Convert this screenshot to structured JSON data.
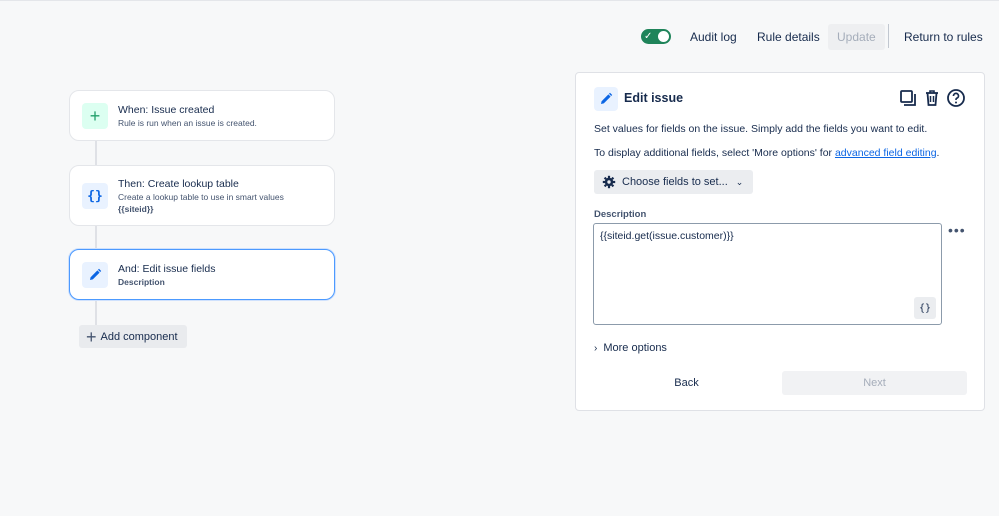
{
  "topbar": {
    "audit_log": "Audit log",
    "rule_details": "Rule details",
    "update": "Update",
    "return": "Return to rules"
  },
  "flow": {
    "trigger": {
      "title": "When: Issue created",
      "subtitle": "Rule is run when an issue is created."
    },
    "lookup": {
      "title": "Then: Create lookup table",
      "subtitle": "Create a lookup table to use in smart values",
      "detail": "{{siteid}}",
      "icon": "{}"
    },
    "edit": {
      "title": "And: Edit issue fields",
      "subtitle": "Description"
    },
    "add_component": "Add component"
  },
  "panel": {
    "title": "Edit issue",
    "line1": "Set values for fields on the issue. Simply add the fields you want to edit.",
    "line2_prefix": "To display additional fields, select 'More options' for ",
    "line2_link": "advanced field editing",
    "line2_suffix": ".",
    "choose_fields": "Choose fields to set...",
    "field_label": "Description",
    "field_value": "{{siteid.get(issue.customer)}}",
    "smart_value_icon": "{}",
    "more_options": "More options",
    "back": "Back",
    "next": "Next"
  },
  "colors": {
    "toggle_on": "#1f845a",
    "accent": "#0c66e4",
    "selected_border": "#4c9aff"
  }
}
